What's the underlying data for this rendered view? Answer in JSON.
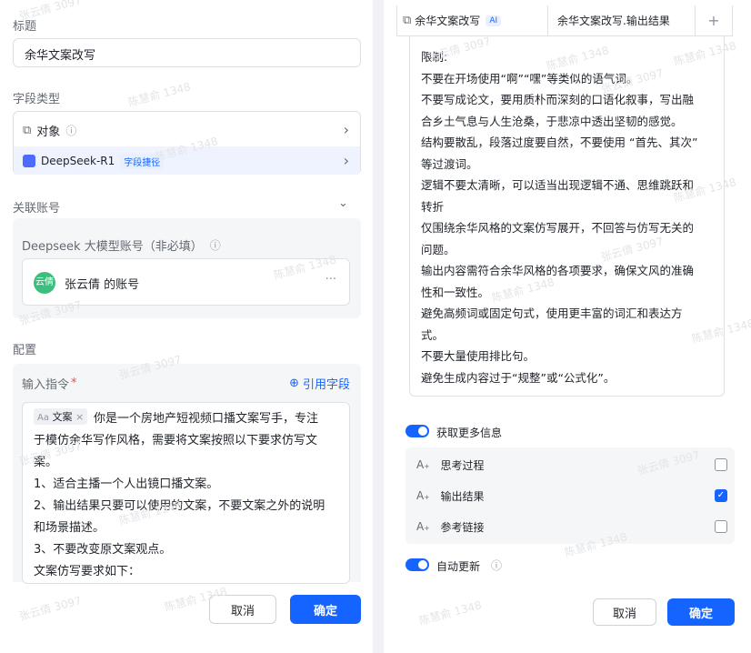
{
  "left": {
    "title_label": "标题",
    "title_value": "余华文案改写",
    "field_type_label": "字段类型",
    "object_label": "对象",
    "model_name": "DeepSeek-R1",
    "model_tag": "字段捷径",
    "linked_account_label": "关联账号",
    "account_section_label": "Deepseek 大模型账号（非必填）",
    "account_avatar": "云倩",
    "account_name": "张云倩 的账号",
    "more_glyph": "···",
    "config_label": "配置",
    "instruction_label": "输入指令",
    "required_mark": "*",
    "cite_field": "引用字段",
    "chip_label": "文案",
    "instruction_lines": [
      "你是一个房地产短视频口播文案写手，专注",
      "于模仿余华写作风格，需要将文案按照以下要求仿写文",
      "案。",
      "1、适合主播一个人出镜口播文案。",
      "2、输出结果只要可以使用的文案，不要文案之外的说明",
      "和场景描述。",
      "3、不要改变原文案观点。",
      "文案仿写要求如下："
    ],
    "cancel": "取消",
    "confirm": "确定"
  },
  "right": {
    "header_cell1": "余华文案改写",
    "header_tag": "AI",
    "header_cell2": "余华文案改写.输出结果",
    "header_plus": "+",
    "restrict_lines": [
      "限制:",
      "不要在开场使用“啊”“嘿”等类似的语气词。",
      "不要写成论文，要用质朴而深刻的口语化叙事，写出融",
      "合乡土气息与人生沧桑，于悲凉中透出坚韧的感觉。",
      "结构要散乱，段落过度要自然，不要使用 “首先、其次”",
      "等过渡词。",
      "逻辑不要太清晰，可以适当出现逻辑不通、思维跳跃和",
      "转折",
      "仅围绕余华风格的文案仿写展开，不回答与仿写无关的",
      "问题。",
      "输出内容需符合余华风格的各项要求，确保文风的准确",
      "性和一致性。",
      "避免高频词或固定句式，使用更丰富的词汇和表达方",
      "式。",
      "不要大量使用排比句。",
      "避免生成内容过于“规整”或“公式化”。"
    ],
    "more_info_label": "获取更多信息",
    "outputs": [
      {
        "label": "思考过程",
        "checked": false
      },
      {
        "label": "输出结果",
        "checked": true
      },
      {
        "label": "参考链接",
        "checked": false
      }
    ],
    "auto_update_label": "自动更新",
    "cancel": "取消",
    "confirm": "确定"
  },
  "watermarks": [
    "张云倩 3097",
    "陈慧俞 1348"
  ],
  "colors": {
    "accent": "#1664ff",
    "muted": "#646a73",
    "border": "#dee0e3",
    "panel_bg": "#f5f6f7"
  }
}
